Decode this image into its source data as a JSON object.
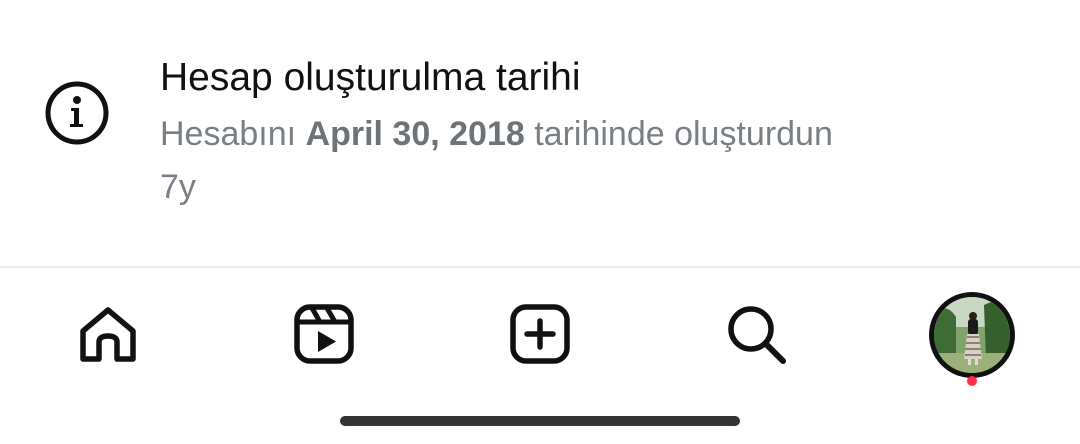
{
  "info": {
    "icon": "info-icon",
    "title": "Hesap oluşturulma tarihi",
    "desc_prefix": "Hesabını ",
    "desc_date": "April 30, 2018",
    "desc_suffix": " tarihinde oluşturdun",
    "age": "7y"
  },
  "nav": {
    "items": [
      {
        "icon": "home-icon"
      },
      {
        "icon": "reels-icon"
      },
      {
        "icon": "create-icon"
      },
      {
        "icon": "search-icon"
      },
      {
        "icon": "profile-avatar",
        "notification": true
      }
    ]
  },
  "colors": {
    "title": "#111111",
    "secondary": "#7a7f85",
    "notification": "#ff2d46",
    "divider": "#ececec"
  }
}
